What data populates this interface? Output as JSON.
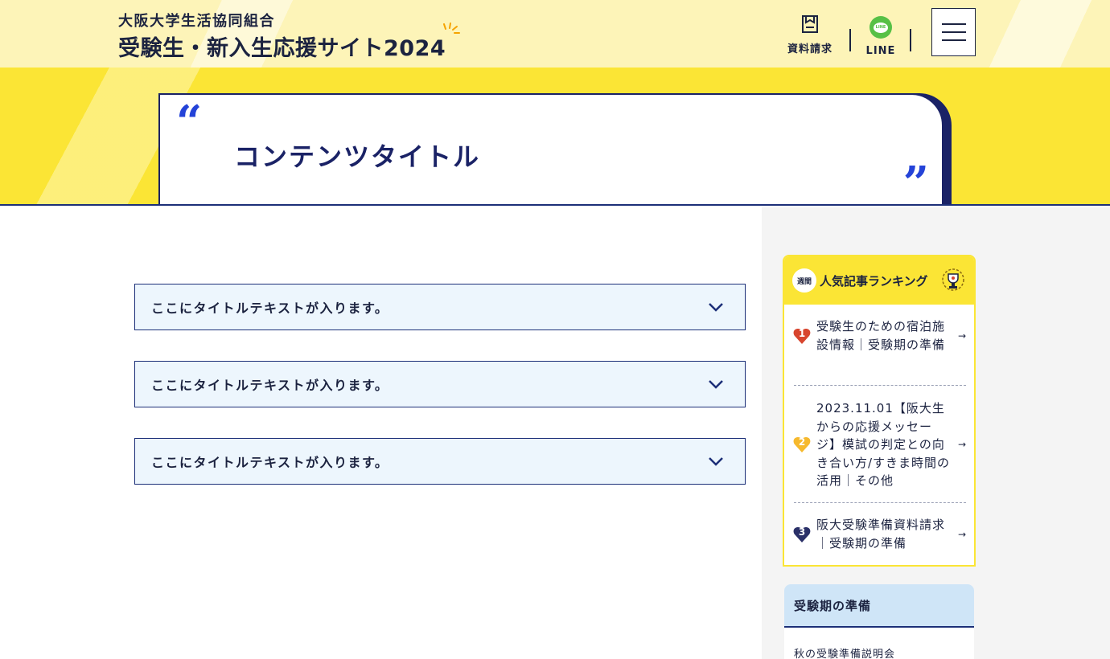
{
  "header": {
    "org_name": "大阪大学生活協同組合",
    "site_name": "受験生・新入生応援サイト2024",
    "doc_request_label": "資料請求",
    "line_label": "LINE",
    "line_icon_text": "LINE"
  },
  "hero": {
    "title": "コンテンツタイトル",
    "quote_open": "“",
    "quote_close": "”"
  },
  "accordions": [
    {
      "title": "ここにタイトルテキストが入ります。"
    },
    {
      "title": "ここにタイトルテキストが入ります。"
    },
    {
      "title": "ここにタイトルテキストが入ります。"
    }
  ],
  "ranking": {
    "badge": "週間",
    "title": "人気記事ランキング",
    "items": [
      {
        "rank": "1",
        "text": "受験生のための宿泊施設情報｜受験期の準備",
        "color": "#d8452e"
      },
      {
        "rank": "2",
        "text": "2023.11.01【阪大生からの応援メッセージ】模試の判定との向き合い方/すきま時間の活用｜その他",
        "color": "#f6b92d"
      },
      {
        "rank": "3",
        "text": "阪大受験準備資料請求｜受験期の準備",
        "color": "#2a3068"
      }
    ],
    "arrow": "→"
  },
  "category": {
    "title": "受験期の準備",
    "links": [
      "秋の受験準備説明会"
    ]
  },
  "colors": {
    "navy": "#1c2340",
    "hero_yellow": "#fbe535",
    "header_yellow": "#fdf4b8",
    "quote_blue": "#2443d8",
    "line_green": "#57c046",
    "accordion_bg": "#edf6fd"
  },
  "icons": {
    "doc_request": "document-icon",
    "line": "line-app-icon",
    "menu": "hamburger-icon",
    "accordion": "chevron-down-icon",
    "ranking": "trophy-icon",
    "rank_marker": "heart-icon"
  }
}
